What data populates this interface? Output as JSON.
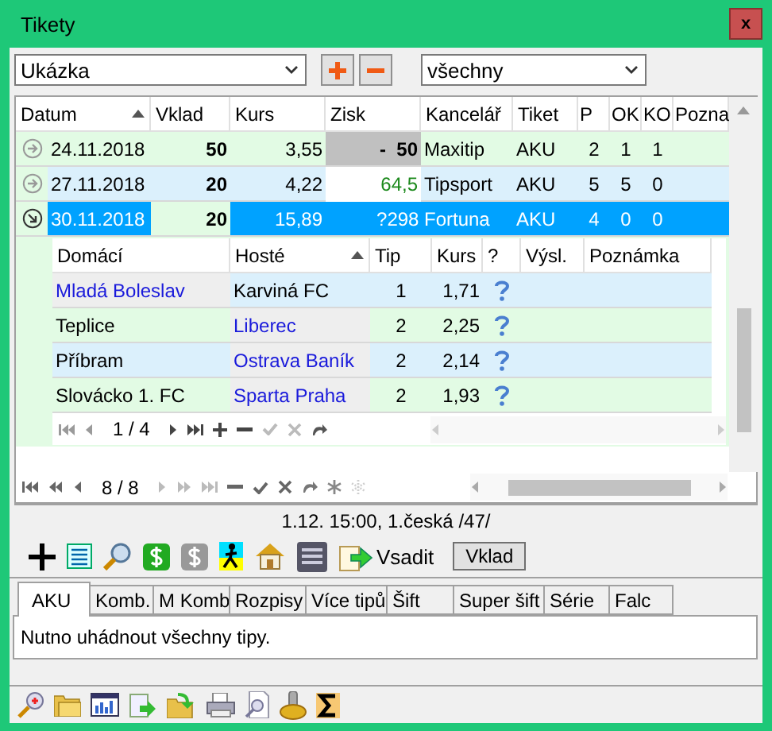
{
  "window": {
    "title": "Tikety",
    "close": "x"
  },
  "filter": {
    "profile": "Ukázka",
    "scope": "všechny"
  },
  "tickets": {
    "columns": [
      {
        "label": "Datum",
        "sorted": true
      },
      {
        "label": "Vklad",
        "sorted": false
      },
      {
        "label": "Kurs",
        "sorted": false
      },
      {
        "label": "Zisk",
        "sorted": false
      },
      {
        "label": "Kancelář",
        "sorted": false
      },
      {
        "label": "Tiket",
        "sorted": false
      },
      {
        "label": "P",
        "sorted": false
      },
      {
        "label": "OK",
        "sorted": false
      },
      {
        "label": "KO",
        "sorted": false
      },
      {
        "label": "Pozna",
        "sorted": false
      }
    ],
    "rows": [
      {
        "date": "24.11.2018",
        "stake": "50",
        "odds": "3,55",
        "profit_flag": "",
        "profit": "-  50",
        "kind": "loss",
        "bookmaker": "Maxitip",
        "ticket": "AKU",
        "p": "2",
        "ok": "1",
        "ko": "1",
        "expanded": false,
        "selected": false
      },
      {
        "date": "27.11.2018",
        "stake": "20",
        "odds": "4,22",
        "profit_flag": "",
        "profit": "64,5",
        "kind": "win",
        "bookmaker": "Tipsport",
        "ticket": "AKU",
        "p": "5",
        "ok": "5",
        "ko": "0",
        "expanded": false,
        "selected": false
      },
      {
        "date": "30.11.2018",
        "stake": "20",
        "odds": "15,89",
        "profit_flag": "?",
        "profit": "298",
        "kind": "pending",
        "bookmaker": "Fortuna",
        "ticket": "AKU",
        "p": "4",
        "ok": "0",
        "ko": "0",
        "expanded": true,
        "selected": true
      }
    ],
    "details": {
      "columns": [
        {
          "label": "Domácí",
          "sorted": false
        },
        {
          "label": "Hosté",
          "sorted": true
        },
        {
          "label": "Tip",
          "sorted": false
        },
        {
          "label": "Kurs",
          "sorted": false
        },
        {
          "label": "?",
          "sorted": false
        },
        {
          "label": "Výsl.",
          "sorted": false
        },
        {
          "label": "Poznámka",
          "sorted": false
        }
      ],
      "rows": [
        {
          "home": "Mladá Boleslav",
          "away": "Karviná FC",
          "tip": "1",
          "odds": "1,71",
          "home_tipped": true,
          "away_tipped": false
        },
        {
          "home": "Teplice",
          "away": "Liberec",
          "tip": "2",
          "odds": "2,25",
          "home_tipped": false,
          "away_tipped": true
        },
        {
          "home": "Příbram",
          "away": "Ostrava Baník",
          "tip": "2",
          "odds": "2,14",
          "home_tipped": false,
          "away_tipped": true
        },
        {
          "home": "Slovácko 1. FC",
          "away": "Sparta Praha",
          "tip": "2",
          "odds": "1,93",
          "home_tipped": false,
          "away_tipped": true
        }
      ],
      "position": "1 / 4"
    },
    "position": "8 / 8"
  },
  "match_info": "1.12. 15:00, 1.česká /47/",
  "toolbar": {
    "bet": "Vsadit",
    "stake": "Vklad"
  },
  "tabs": [
    {
      "label": "AKU",
      "selected": true
    },
    {
      "label": "Komb.",
      "selected": false
    },
    {
      "label": "M Komb",
      "selected": false
    },
    {
      "label": "Rozpisy",
      "selected": false
    },
    {
      "label": "Více tipů",
      "selected": false
    },
    {
      "label": "Šift",
      "selected": false
    },
    {
      "label": "Super šift",
      "selected": false
    },
    {
      "label": "Série",
      "selected": false
    },
    {
      "label": "Falc",
      "selected": false
    }
  ],
  "tab_text": "Nutno uhádnout všechny tipy."
}
